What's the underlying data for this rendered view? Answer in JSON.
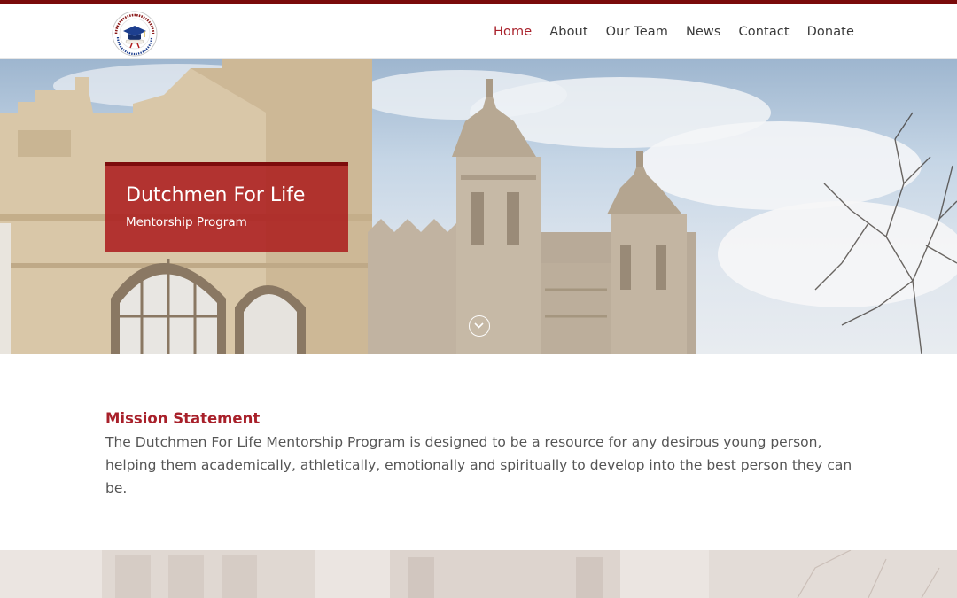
{
  "header": {
    "logo_icon": "dutchmen-for-life-logo",
    "nav": [
      {
        "label": "Home",
        "active": true
      },
      {
        "label": "About"
      },
      {
        "label": "Our Team"
      },
      {
        "label": "News"
      },
      {
        "label": "Contact"
      },
      {
        "label": "Donate"
      }
    ]
  },
  "hero": {
    "title": "Dutchmen For Life",
    "subtitle": "Mentorship Program",
    "scroll_icon": "chevron-down-circle-icon"
  },
  "mission": {
    "title": "Mission Statement",
    "text": "The Dutchmen For Life Mentorship Program is designed to be a resource for any desirous young person, helping them academically, athletically, emotionally and spiritually to develop into the best person they can be."
  },
  "colors": {
    "accent": "#a8202a",
    "topbar": "#7a0a0a",
    "card": "#ac1f1f"
  }
}
